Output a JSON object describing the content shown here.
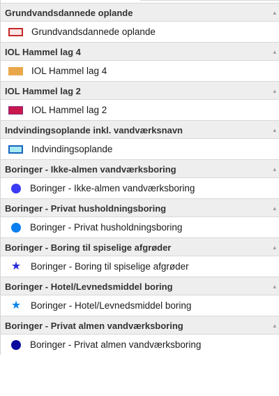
{
  "groups": [
    {
      "header": "Grundvandsdannede oplande",
      "item": {
        "label": "Grundvandsdannede oplande",
        "symbol": "outlined-rect-icon",
        "fill": "#fbe5e5",
        "stroke": "#c62828"
      }
    },
    {
      "header": "IOL Hammel lag 4",
      "item": {
        "label": "IOL Hammel lag 4",
        "symbol": "filled-rect-icon",
        "fill": "#e8a84a",
        "stroke": "#e8a84a"
      }
    },
    {
      "header": "IOL Hammel lag 2",
      "item": {
        "label": "IOL Hammel lag 2",
        "symbol": "filled-rect-icon",
        "fill": "#c8174d",
        "stroke": "#8e2a7a"
      }
    },
    {
      "header": "Indvindingsoplande inkl. vandværksnavn",
      "item": {
        "label": "Indvindingsoplande",
        "symbol": "outlined-rect-icon",
        "fill": "#a9e9f3",
        "stroke": "#1565c0"
      }
    },
    {
      "header": "Boringer - Ikke-almen vandværksboring",
      "item": {
        "label": "Boringer - Ikke-almen vandværksboring",
        "symbol": "dot-icon",
        "fill": "#3b3bf5"
      }
    },
    {
      "header": "Boringer - Privat husholdningsboring",
      "item": {
        "label": "Boringer - Privat husholdningsboring",
        "symbol": "dot-icon",
        "fill": "#0a7ff0"
      }
    },
    {
      "header": "Boringer - Boring til spiselige afgrøder",
      "item": {
        "label": "Boringer - Boring til spiselige afgrøder",
        "symbol": "star-icon",
        "fill": "#2b2bd8"
      }
    },
    {
      "header": "Boringer - Hotel/Levnedsmiddel boring",
      "item": {
        "label": "Boringer - Hotel/Levnedsmiddel boring",
        "symbol": "star-icon",
        "fill": "#0b86e8"
      }
    },
    {
      "header": "Boringer - Privat almen vandværksboring",
      "item": {
        "label": "Boringer - Privat almen vandværksboring",
        "symbol": "dot-icon",
        "fill": "#0a0a9e"
      }
    }
  ],
  "caret_glyph": "▴"
}
